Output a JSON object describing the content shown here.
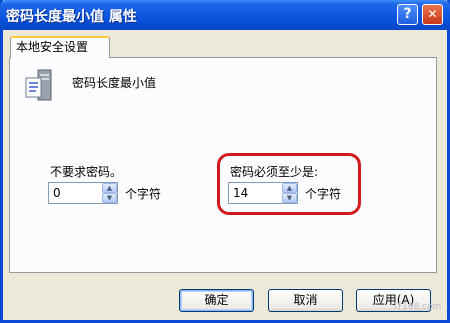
{
  "window": {
    "title": "密码长度最小值 属性",
    "help_button": "?",
    "close_button": "✕"
  },
  "tabs": [
    {
      "label": "本地安全设置"
    }
  ],
  "policy": {
    "icon": "policy-server-icon",
    "name": "密码长度最小值"
  },
  "option_none": {
    "label": "不要求密码。",
    "value": "0",
    "unit": "个字符"
  },
  "option_min": {
    "label": "密码必须至少是:",
    "value": "14",
    "unit": "个字符",
    "highlight_color": "#D21A1A"
  },
  "buttons": {
    "ok": "确定",
    "cancel": "取消",
    "apply": "应用(A)"
  },
  "watermark": "IT168.com"
}
